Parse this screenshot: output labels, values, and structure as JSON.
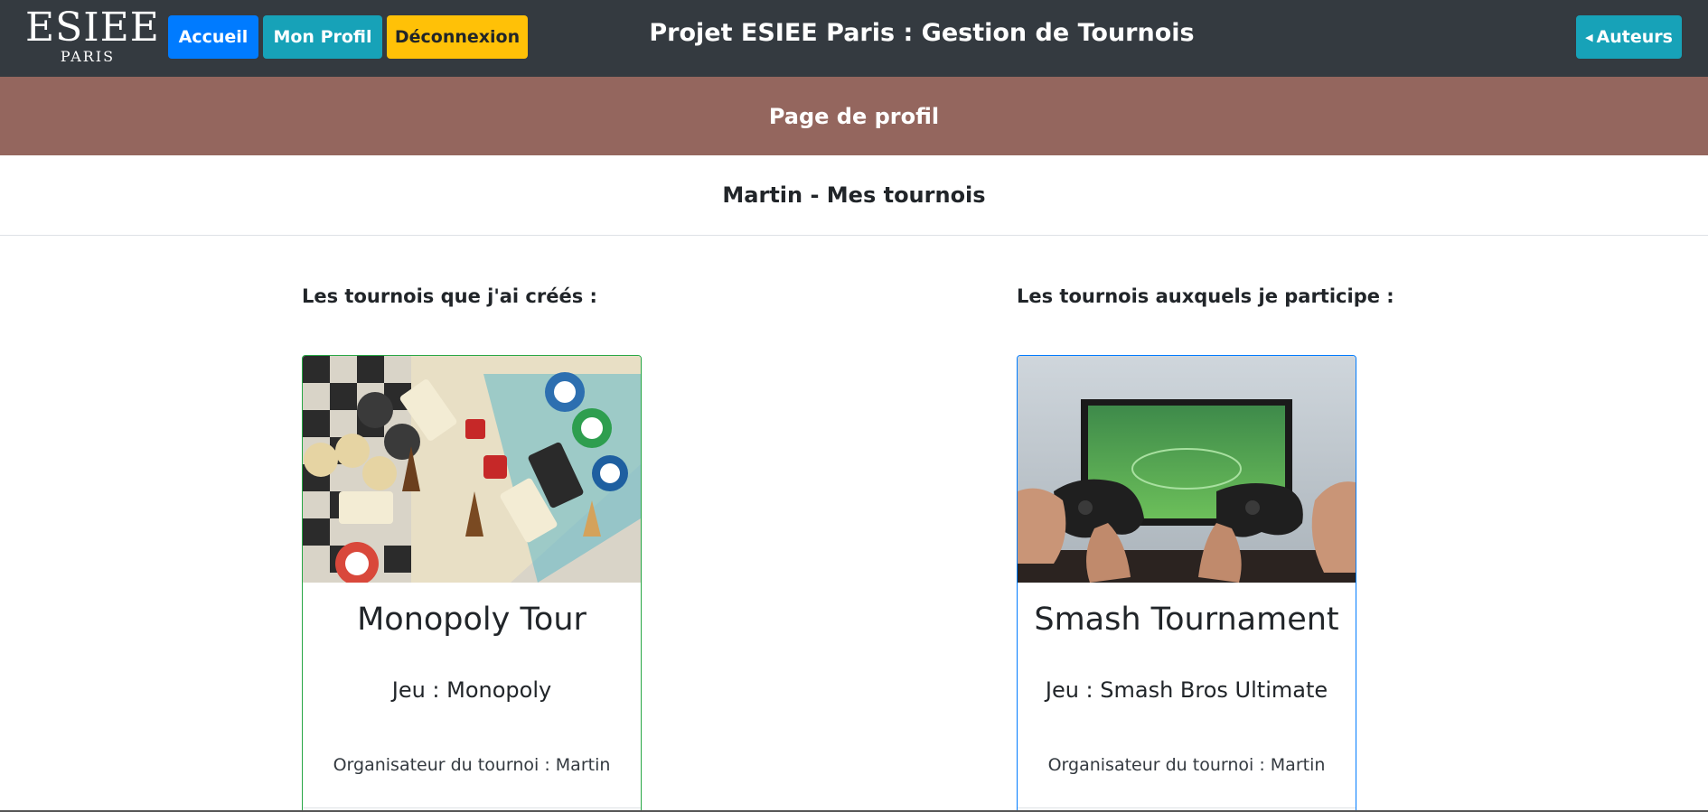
{
  "navbar": {
    "logo_main": "ESIEE",
    "logo_sub": "PARIS",
    "home_label": "Accueil",
    "profile_label": "Mon Profil",
    "logout_label": "Déconnexion",
    "title": "Projet ESIEE Paris : Gestion de Tournois",
    "authors_label": "Auteurs",
    "authors_icon": "caret-left-icon"
  },
  "banner": {
    "title": "Page de profil"
  },
  "subheader": {
    "title": "Martin - Mes tournois"
  },
  "created": {
    "heading": "Les tournois que j'ai créés :",
    "cards": [
      {
        "image": "board-games-photo",
        "title": "Monopoly Tour",
        "game": "Jeu : Monopoly",
        "organizer": "Organisateur du tournoi : Martin",
        "border_color": "#28a745"
      }
    ]
  },
  "participating": {
    "heading": "Les tournois auxquels je participe :",
    "cards": [
      {
        "image": "video-game-controllers-photo",
        "title": "Smash Tournament",
        "game": "Jeu : Smash Bros Ultimate",
        "organizer": "Organisateur du tournoi : Martin",
        "border_color": "#007bff"
      }
    ]
  },
  "colors": {
    "navbar_bg": "#343a40",
    "banner_bg": "#94665e",
    "primary": "#007bff",
    "info": "#17a2b8",
    "warning": "#ffc107",
    "success": "#28a745"
  }
}
